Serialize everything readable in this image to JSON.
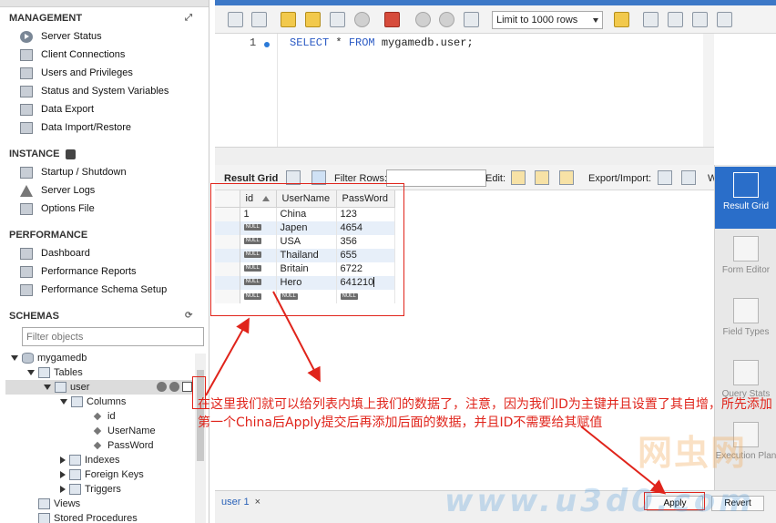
{
  "navigator": {
    "management": {
      "title": "MANAGEMENT",
      "items": [
        "Server Status",
        "Client Connections",
        "Users and Privileges",
        "Status and System Variables",
        "Data Export",
        "Data Import/Restore"
      ]
    },
    "instance": {
      "title": "INSTANCE",
      "items": [
        "Startup / Shutdown",
        "Server Logs",
        "Options File"
      ]
    },
    "performance": {
      "title": "PERFORMANCE",
      "items": [
        "Dashboard",
        "Performance Reports",
        "Performance Schema Setup"
      ]
    },
    "schemas": {
      "title": "SCHEMAS",
      "filter_placeholder": "Filter objects",
      "tree": {
        "db": "mygamedb",
        "tables": "Tables",
        "table": "user",
        "columns": "Columns",
        "column_names": [
          "id",
          "UserName",
          "PassWord"
        ],
        "indexes": "Indexes",
        "foreign_keys": "Foreign Keys",
        "triggers": "Triggers",
        "views": "Views",
        "stored_procedures": "Stored Procedures"
      }
    }
  },
  "toolbar": {
    "limit": "Limit to 1000 rows"
  },
  "editor": {
    "line_number": "1",
    "code": {
      "select": "SELECT",
      "star": "*",
      "from": "FROM",
      "target": "mygamedb.user;"
    }
  },
  "result_bar": {
    "result_grid": "Result Grid",
    "filter_rows": "Filter Rows:",
    "edit": "Edit:",
    "export_import": "Export/Import:",
    "wrap": "W"
  },
  "grid": {
    "columns": [
      "id",
      "UserName",
      "PassWord"
    ],
    "rows": [
      {
        "id": "1",
        "name": "China",
        "pass": "123"
      },
      {
        "id": "NULL",
        "name": "Japen",
        "pass": "4654"
      },
      {
        "id": "NULL",
        "name": "USA",
        "pass": "356"
      },
      {
        "id": "NULL",
        "name": "Thailand",
        "pass": "655"
      },
      {
        "id": "NULL",
        "name": "Britain",
        "pass": "6722"
      },
      {
        "id": "NULL",
        "name": "Hero",
        "pass": "641210"
      }
    ],
    "new_row": {
      "id": "NULL",
      "name": "NULL",
      "pass": "NULL"
    }
  },
  "side_panel": {
    "result_grid": "Result Grid",
    "form_editor": "Form Editor",
    "field_types": "Field Types",
    "query_stats": "Query Stats",
    "execution_plan": "Execution Plan"
  },
  "bottom": {
    "tab": "user 1",
    "close": "×",
    "apply": "Apply",
    "revert": "Revert"
  },
  "annotation": {
    "text": "在这里我们就可以给列表内填上我们的数据了，注意，因为我们ID为主键并且设置了其自增，所先添加第一个China后Apply提交后再添加后面的数据，并且ID不需要给其赋值"
  },
  "watermarks": [
    "网虫网",
    "www.u3d0.com"
  ],
  "colors": {
    "annotation_red": "#e0241b",
    "accent_blue": "#2a6ec9",
    "keyword_blue": "#2b5ac4"
  }
}
